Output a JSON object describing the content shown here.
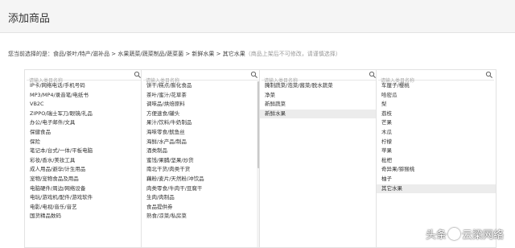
{
  "header": {
    "title": "添加商品"
  },
  "breadcrumb": {
    "prefix": "您当前选择的是：",
    "path": "食品/茶叶/特产/滋补品 > 水果蔬菜/蔬菜制品/蔬菜菌 > 新鲜水果 > 其它水果",
    "note": "（商品上架后不可修改，请谨慎选择）"
  },
  "columns": [
    {
      "placeholder": "请输入类目名称",
      "items": [
        "IP卡/网络电话/手机号码",
        "MP3/MP4/录音笔/电纸书",
        "VB2C",
        "ZIPPO/瑞士军刀/眼镜/礼品",
        "办公/电子邮件/文具",
        "保健食品",
        "保险",
        "笔记本/台式/一体/平板电脑",
        "彩妆/香水/美妆工具",
        "成人用品/避孕/计生用品",
        "宠物/宠物食品及用品",
        "电脑硬件/周边/网络设备",
        "电玩/游戏机/配件/游戏软件",
        "电影/电视/音乐/音艺",
        "国货精品数码"
      ],
      "selected_index": -1,
      "has_scrollbar": false
    },
    {
      "placeholder": "请输入类目名称",
      "items": [
        "饼干/糕点/膨化食品",
        "茶叶/蜜汁/花草茶",
        "调味品/烘焙原料",
        "方便速食/罐头",
        "果汁/饮料/牛奶制品",
        "海味零食/鱿鱼丝",
        "海鲜/水产品/制品",
        "酒类制品",
        "蜜饯/果脯/坚果/炒货",
        "南北干货/肉类干货",
        "藕粉/麦片/天然粉/冲饮品",
        "肉类零食/牛肉干/豆腐干",
        "生肉/肉制品",
        "食品提供券",
        "熟食/凉菜/私房菜"
      ],
      "selected_index": -1,
      "has_scrollbar": true
    },
    {
      "placeholder": "请输入类目名称",
      "items": [
        "腌制蔬菜/泡菜/酱菜/脱水蔬菜",
        "净菜",
        "新鲜蔬菜",
        "新鲜水果"
      ],
      "selected_index": 3,
      "has_scrollbar": false
    },
    {
      "placeholder": "请输入类目名称",
      "items": [
        "车厘子/樱桃",
        "哈密瓜",
        "梨",
        "荔枝",
        "芒果",
        "木瓜",
        "柠檬",
        "苹果",
        "枇杷",
        "奇异果/猕猴桃",
        "柚子",
        "其它水果"
      ],
      "selected_index": 11,
      "has_scrollbar": false
    }
  ],
  "watermark": {
    "prefix": "头条",
    "at": "@",
    "name": "云梁网络"
  },
  "colors": {
    "selected_bg": "#ececec",
    "border": "#e2e2e2",
    "header_bg": "#f5f5f5"
  }
}
